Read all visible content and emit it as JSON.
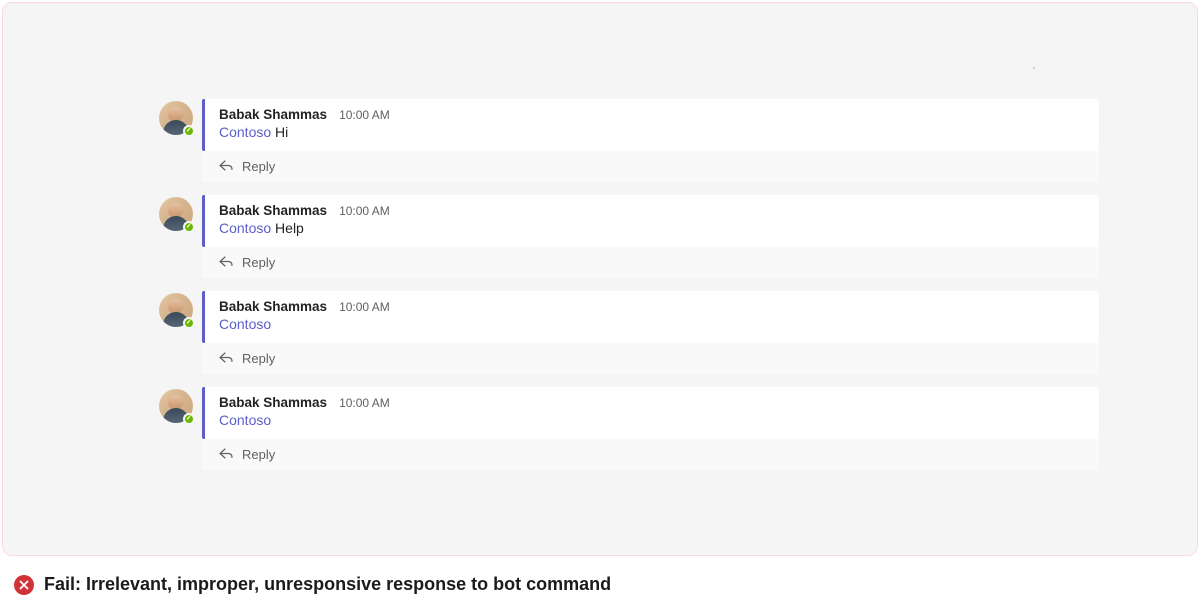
{
  "colors": {
    "accent": "#5b5fc7",
    "fail": "#d13438",
    "presence": "#6bb700"
  },
  "messages": [
    {
      "author": "Babak Shammas",
      "timestamp": "10:00 AM",
      "mention": "Contoso",
      "body": "Hi",
      "reply_label": "Reply"
    },
    {
      "author": "Babak Shammas",
      "timestamp": "10:00 AM",
      "mention": "Contoso",
      "body": "Help",
      "reply_label": "Reply"
    },
    {
      "author": "Babak Shammas",
      "timestamp": "10:00 AM",
      "mention": "Contoso",
      "body": "",
      "reply_label": "Reply"
    },
    {
      "author": "Babak Shammas",
      "timestamp": "10:00 AM",
      "mention": "Contoso",
      "body": "",
      "reply_label": "Reply"
    }
  ],
  "caption": {
    "text": "Fail: Irrelevant, improper, unresponsive response to bot command"
  }
}
